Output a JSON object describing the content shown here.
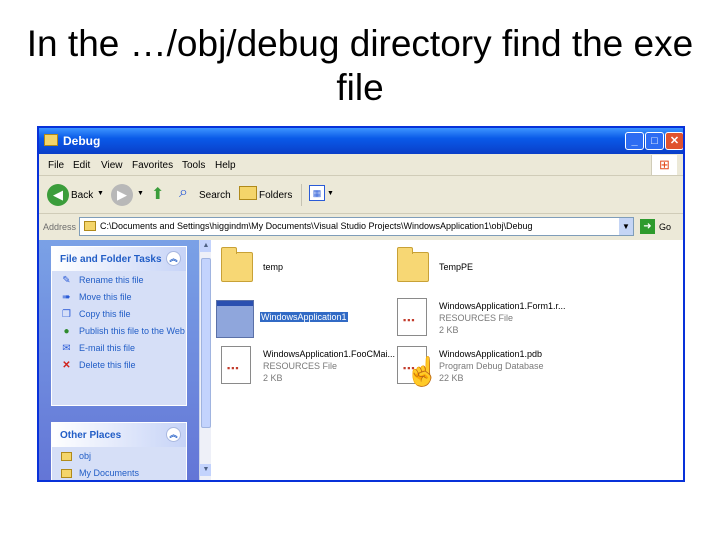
{
  "slide": {
    "title": "In the …/obj/debug directory find the exe file"
  },
  "window": {
    "title": "Debug",
    "menu": [
      "File",
      "Edit",
      "View",
      "Favorites",
      "Tools",
      "Help"
    ],
    "toolbar": {
      "back": "Back",
      "search": "Search",
      "folders": "Folders"
    },
    "address": {
      "label": "Address",
      "path": "C:\\Documents and Settings\\higgindm\\My Documents\\Visual Studio Projects\\WindowsApplication1\\obj\\Debug",
      "go": "Go"
    },
    "controls": {
      "minimize": "_",
      "maximize": "□",
      "close": "✕"
    }
  },
  "left_pane": {
    "tasks": {
      "heading": "File and Folder Tasks",
      "items": [
        {
          "label": "Rename this file",
          "icon": "rename-icon"
        },
        {
          "label": "Move this file",
          "icon": "move-icon"
        },
        {
          "label": "Copy this file",
          "icon": "copy-icon"
        },
        {
          "label": "Publish this file to the Web",
          "icon": "publish-icon"
        },
        {
          "label": "E-mail this file",
          "icon": "email-icon"
        },
        {
          "label": "Delete this file",
          "icon": "delete-icon"
        }
      ]
    },
    "other_places": {
      "heading": "Other Places",
      "items": [
        {
          "label": "obj",
          "icon": "folder-icon"
        },
        {
          "label": "My Documents",
          "icon": "folder-icon"
        }
      ]
    }
  },
  "files": [
    {
      "name": "temp",
      "type": "",
      "size": "",
      "icon": "folder-icon"
    },
    {
      "name": "TempPE",
      "type": "",
      "size": "",
      "icon": "folder-icon"
    },
    {
      "name": "WindowsApplication1",
      "type": "",
      "size": "",
      "icon": "exe-icon",
      "selected": true
    },
    {
      "name": "WindowsApplication1.Form1.r...",
      "type": "RESOURCES File",
      "size": "2 KB",
      "icon": "resources-file-icon"
    },
    {
      "name": "WindowsApplication1.FooCMai...",
      "type": "RESOURCES File",
      "size": "2 KB",
      "icon": "resources-file-icon"
    },
    {
      "name": "WindowsApplication1.pdb",
      "type": "Program Debug Database",
      "size": "22 KB",
      "icon": "pdb-file-icon"
    }
  ]
}
